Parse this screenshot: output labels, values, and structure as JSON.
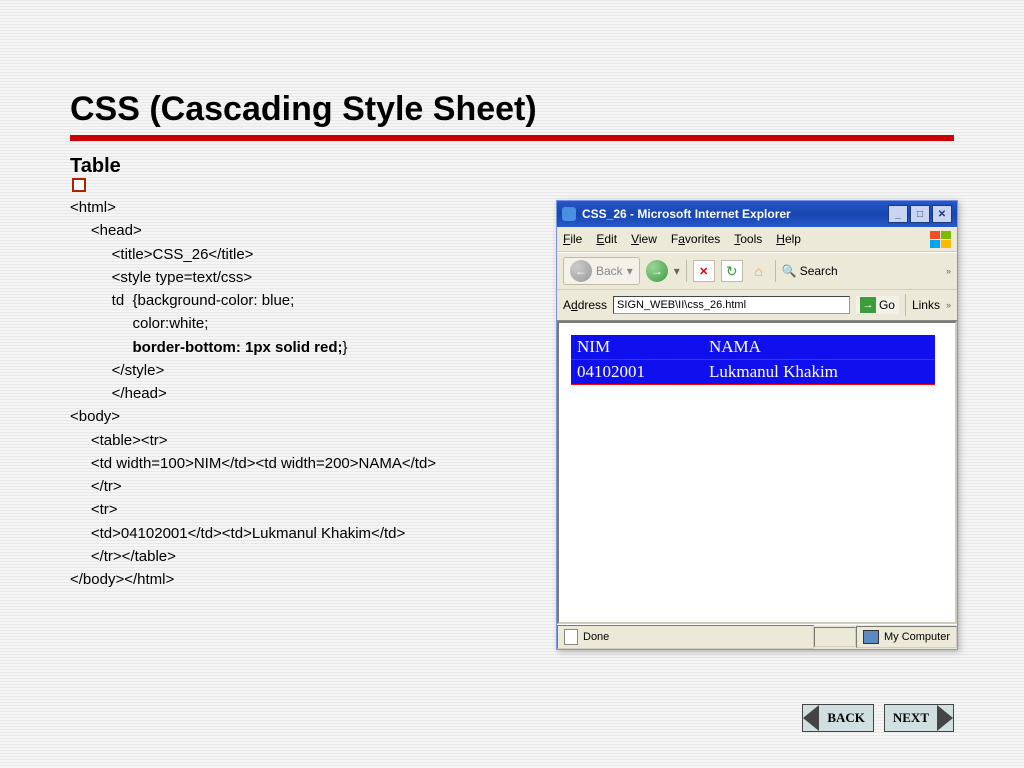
{
  "slide": {
    "title": "CSS (Cascading Style Sheet)",
    "subtitle": "Table"
  },
  "code": {
    "l1": "<html>",
    "l2": "     <head>",
    "l3": "          <title>CSS_26</title>",
    "l4": "          <style type=text/css>",
    "l5pre": "          td  {",
    "l5a": "background-color: blue;",
    "l6": "               color:white;",
    "l7": "               border-bottom: 1px solid red;",
    "l7end": "}",
    "l8": "          </style>",
    "l9": "          </head>",
    "l10": "<body>",
    "l11": "     <table><tr>",
    "l12": "     <td width=100>NIM</td><td width=200>NAMA</td>",
    "l13": "     </tr>",
    "l14": "     <tr>",
    "l15": "     <td>04102001</td><td>Lukmanul Khakim</td>",
    "l16": "     </tr></table>",
    "l17": "</body></html>"
  },
  "browser": {
    "title": "CSS_26 - Microsoft Internet Explorer",
    "menu": {
      "file": "File",
      "edit": "Edit",
      "view": "View",
      "favorites": "Favorites",
      "tools": "Tools",
      "help": "Help"
    },
    "toolbar": {
      "back": "Back",
      "search": "Search"
    },
    "address": {
      "label": "Address",
      "value": "SIGN_WEB\\II\\css_26.html",
      "go": "Go",
      "links": "Links"
    },
    "table": {
      "r1c1": "NIM",
      "r1c2": "NAMA",
      "r2c1": "04102001",
      "r2c2": "Lukmanul Khakim"
    },
    "status": {
      "done": "Done",
      "zone": "My Computer"
    }
  },
  "nav": {
    "back": "BACK",
    "next": "NEXT"
  }
}
